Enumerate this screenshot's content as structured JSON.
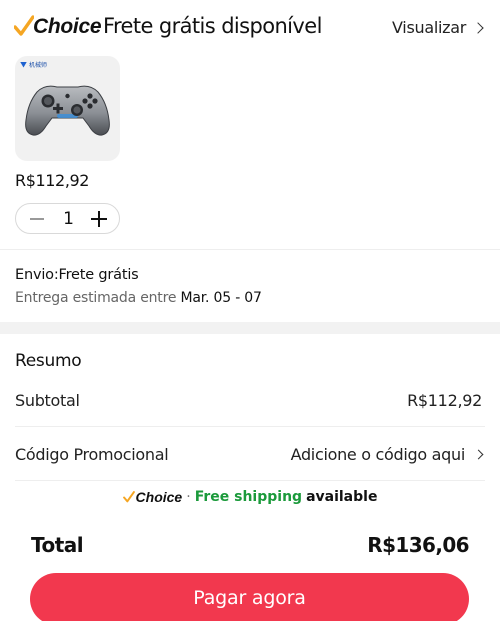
{
  "header": {
    "choice_logo": "Choice",
    "title": "Frete grátis disponível",
    "view_label": "Visualizar",
    "check_color": "#f5a623"
  },
  "product": {
    "brand_badge": "机械师",
    "image_icon": "game-controller-icon",
    "price": "R$112,92",
    "quantity": "1"
  },
  "shipping": {
    "title": "Envio:Frete grátis",
    "estimate_label": "Entrega estimada entre",
    "estimate_dates": "Mar. 05 - 07"
  },
  "summary": {
    "title": "Resumo",
    "subtotal_label": "Subtotal",
    "subtotal_value": "R$112,92",
    "promo_label": "Código Promocional",
    "promo_value": "Adicione o código aqui"
  },
  "choice_banner": {
    "choice": "Choice",
    "separator": "·",
    "free_shipping": "Free shipping",
    "available": "available",
    "free_color": "#1b9a3b"
  },
  "footer": {
    "total_label": "Total",
    "total_value": "R$136,06",
    "pay_label": "Pagar agora",
    "button_color": "#f2384e"
  }
}
